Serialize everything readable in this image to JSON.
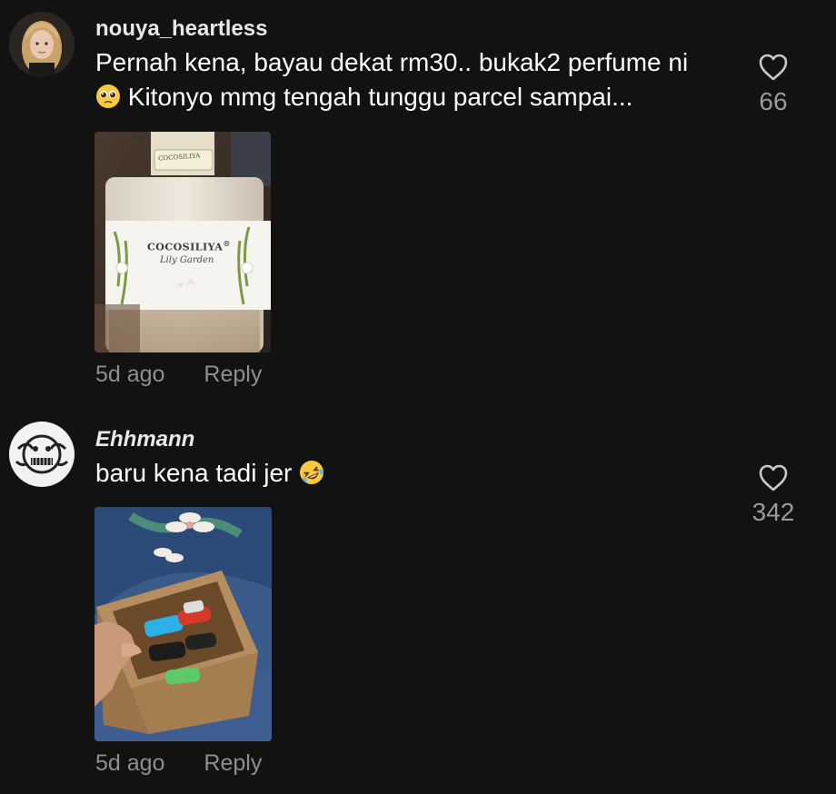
{
  "comments": [
    {
      "username": "nouya_heartless",
      "text_line1": "Pernah kena, bayau dekat rm30.. bukak2 perfume ni",
      "text_line2": "Kitonyo mmg tengah tunggu parcel sampai...",
      "emoji": "pleading-face-emoji",
      "likes": "66",
      "time": "5d ago",
      "reply_label": "Reply",
      "attachment": {
        "brand": "COCOSILIYA",
        "registered": "®",
        "product": "Lily Garden",
        "cap_label": "COCOSILIYA"
      }
    },
    {
      "username": "Ehhmann",
      "text": "baru kena tadi jer",
      "emoji": "rolling-on-floor-laughing-emoji",
      "likes": "342",
      "time": "5d ago",
      "reply_label": "Reply"
    }
  ],
  "colors": {
    "background": "#121212",
    "muted_text": "#8e8e8e",
    "like_count": "#9a9a9a"
  }
}
